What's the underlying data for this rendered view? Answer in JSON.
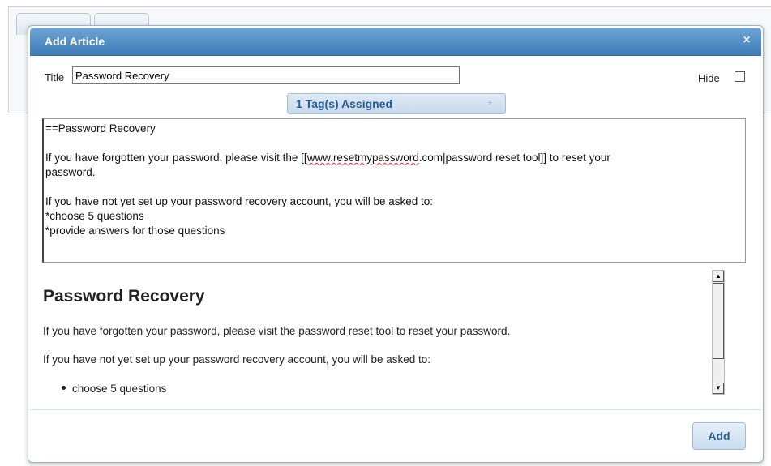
{
  "modal": {
    "title": "Add Article",
    "close_icon": "×"
  },
  "form": {
    "title_label": "Title",
    "title_value": "Password Recovery",
    "hide_label": "Hide",
    "hide_checked": false,
    "tags_label": "1 Tag(s) Assigned",
    "tags_arrow": "÷"
  },
  "editor": {
    "line1": "==Password Recovery",
    "line2_pre": "If you have forgotten your password, please visit the [[",
    "line2_link": "www.resetmypassword",
    "line2_post": ".com|password reset tool]] to reset your",
    "line3": "password.",
    "line4": "If you have not yet set up your password recovery account, you will be asked to:",
    "line5": "*choose 5 questions",
    "line6": "*provide answers for those questions"
  },
  "preview": {
    "heading": "Password Recovery",
    "p1_pre": "If you have forgotten your password, please visit the ",
    "p1_link": "password reset tool",
    "p1_post": " to reset your password.",
    "p2": "If you have not yet set up your password recovery account, you will be asked to:",
    "bullet1": "choose 5 questions"
  },
  "scrollbar": {
    "up_icon": "▲",
    "down_icon": "▼"
  },
  "footer": {
    "add_label": "Add"
  },
  "colors": {
    "header": "#3d7cb8",
    "button_text": "#2a5e94"
  }
}
